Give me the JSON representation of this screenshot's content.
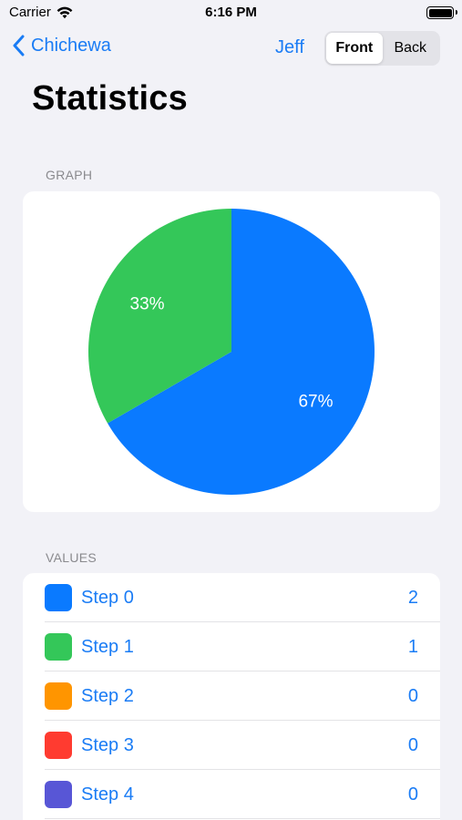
{
  "status_bar": {
    "carrier": "Carrier",
    "time": "6:16 PM"
  },
  "nav": {
    "back_label": "Chichewa",
    "user": "Jeff",
    "segments": [
      {
        "label": "Front",
        "selected": true
      },
      {
        "label": "Back",
        "selected": false
      }
    ]
  },
  "page_title": "Statistics",
  "graph_section": {
    "header": "GRAPH"
  },
  "chart_data": {
    "type": "pie",
    "slices": [
      {
        "name": "Step 0",
        "value": 2,
        "label": "67%",
        "color": "#0A7AFF"
      },
      {
        "name": "Step 1",
        "value": 1,
        "label": "33%",
        "color": "#34C759"
      }
    ],
    "start_angle_deg": 0
  },
  "values_section": {
    "header": "VALUES",
    "rows": [
      {
        "label": "Step 0",
        "value": "2",
        "color": "#0A7AFF"
      },
      {
        "label": "Step 1",
        "value": "1",
        "color": "#34C759"
      },
      {
        "label": "Step 2",
        "value": "0",
        "color": "#FF9500"
      },
      {
        "label": "Step 3",
        "value": "0",
        "color": "#FF3B30"
      },
      {
        "label": "Step 4",
        "value": "0",
        "color": "#5856D6"
      }
    ]
  }
}
